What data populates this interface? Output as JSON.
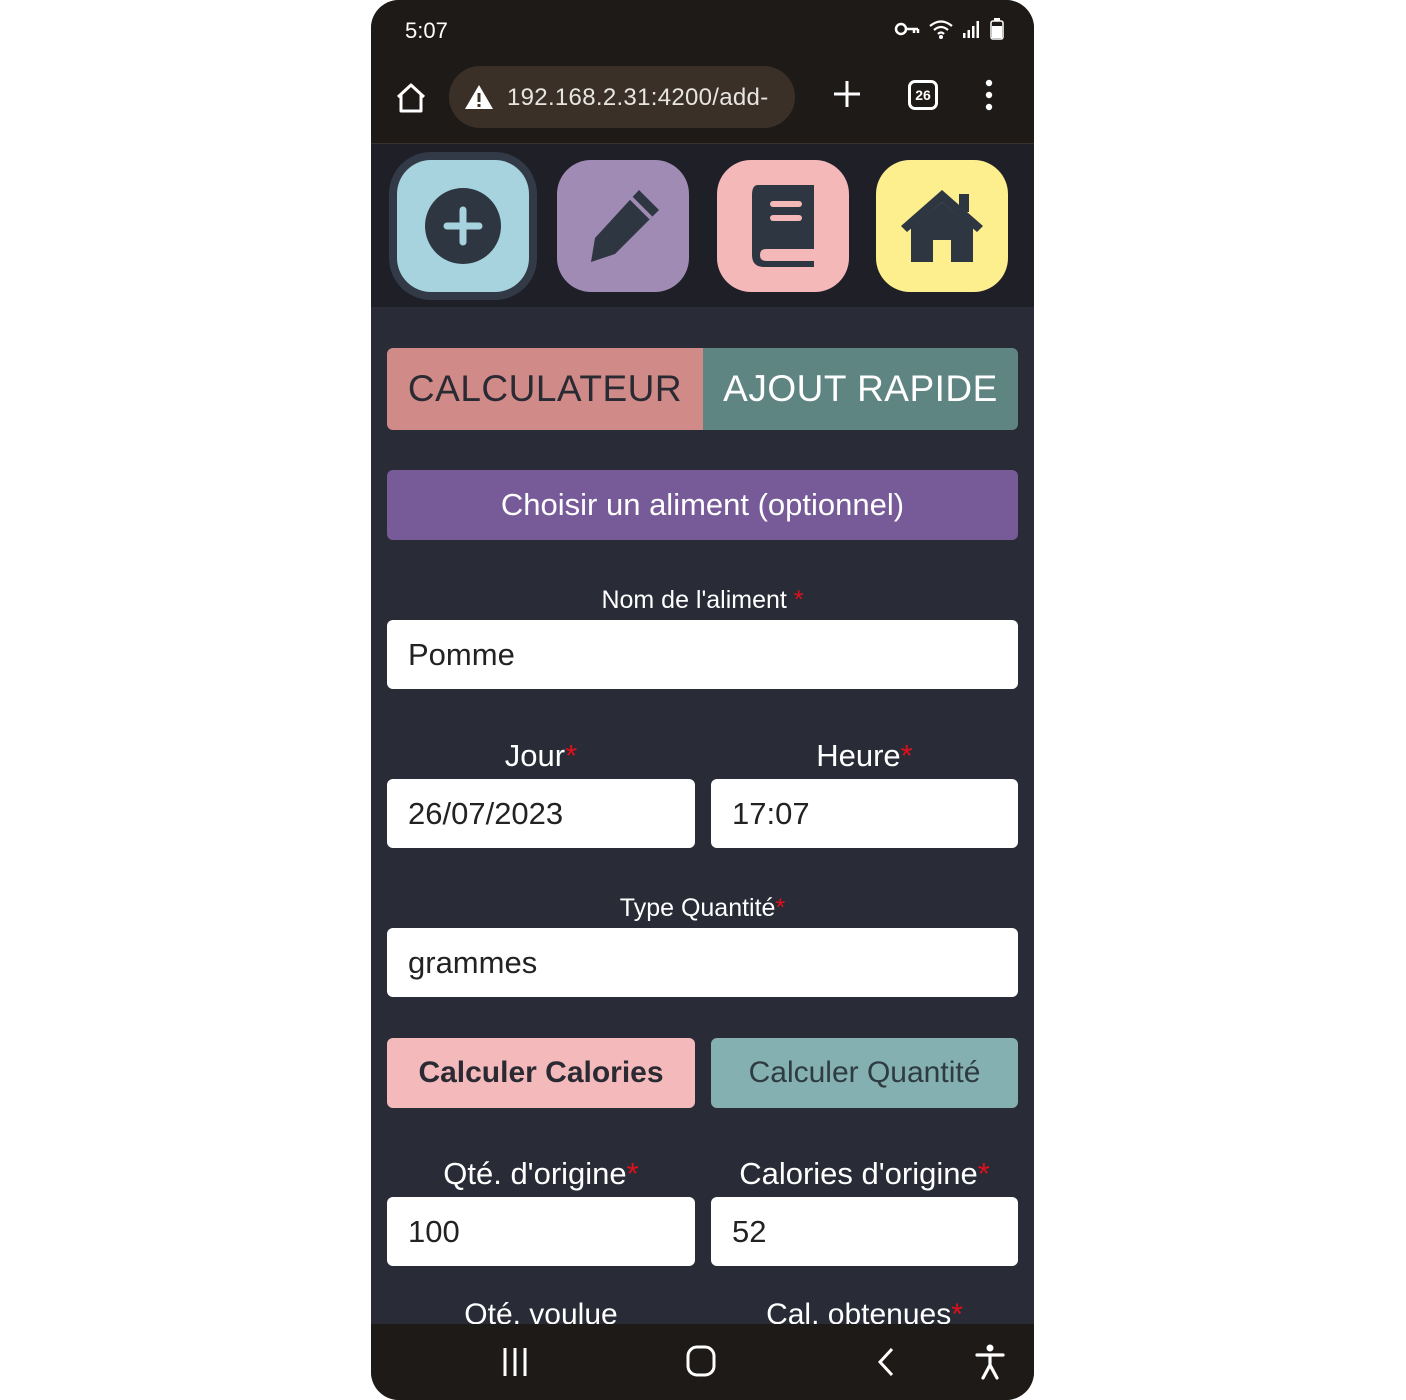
{
  "status_bar": {
    "time": "5:07",
    "icons": [
      "vpn-key-icon",
      "wifi-icon",
      "signal-icon",
      "battery-icon"
    ]
  },
  "browser": {
    "url": "192.168.2.31:4200/add-",
    "tab_count": "26"
  },
  "nav": {
    "buttons": [
      "add-icon",
      "edit-icon",
      "book-icon",
      "home-icon"
    ],
    "active": "add"
  },
  "mode_tabs": {
    "calculator": "CALCULATEUR",
    "quick_add": "AJOUT RAPIDE"
  },
  "choose_food": "Choisir un aliment (optionnel)",
  "form": {
    "food_name": {
      "label": "Nom de l'aliment",
      "required": "*",
      "value": "Pomme"
    },
    "day": {
      "label": "Jour",
      "required": "*",
      "value": "26/07/2023"
    },
    "time": {
      "label": "Heure",
      "required": "*",
      "value": "17:07"
    },
    "quantity_type": {
      "label": "Type Quantité",
      "required": "*",
      "value": "grammes"
    },
    "calc_calories_label": "Calculer Calories",
    "calc_quantity_label": "Calculer Quantité",
    "orig_qty": {
      "label": "Qté. d'origine",
      "required": "*",
      "value": "100"
    },
    "orig_cal": {
      "label": "Calories d'origine",
      "required": "*",
      "value": "52"
    },
    "wanted_qty": {
      "label": "Qté. voulue"
    },
    "cal_obtained": {
      "label": "Cal. obtenues",
      "required": "*"
    }
  },
  "colors": {
    "add": "#a6d3de",
    "edit": "#9f8bb4",
    "book": "#f4b8b8",
    "home": "#fdee8e",
    "calculator_tab": "#d08a88",
    "quick_add_tab": "#5f8583",
    "choose": "#775b98",
    "calc_calories": "#f4b9bb",
    "calc_quantity": "#84b0b1",
    "background": "#292c37"
  }
}
